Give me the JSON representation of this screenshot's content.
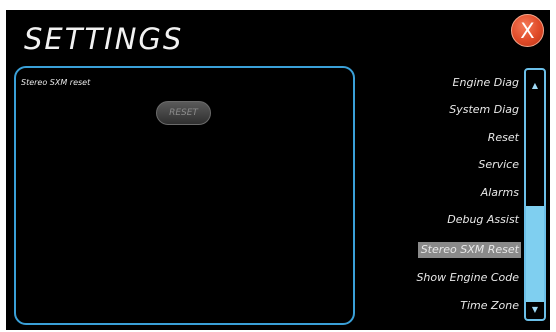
{
  "header": {
    "title": "SETTINGS",
    "close_label": "X"
  },
  "panel": {
    "title": "Stereo SXM reset",
    "reset_label": "RESET"
  },
  "menu": {
    "items": [
      {
        "label": "Engine Diag",
        "selected": false
      },
      {
        "label": "System Diag",
        "selected": false
      },
      {
        "label": "Reset",
        "selected": false
      },
      {
        "label": "Service",
        "selected": false
      },
      {
        "label": "Alarms",
        "selected": false
      },
      {
        "label": "Debug Assist",
        "selected": false
      },
      {
        "label": "Stereo SXM Reset",
        "selected": true
      },
      {
        "label": "Show Engine Code",
        "selected": false
      },
      {
        "label": "Time Zone",
        "selected": false
      }
    ]
  },
  "scrollbar": {
    "up_icon": "chevron-up-icon",
    "down_icon": "chevron-down-icon",
    "position_fraction": 0.55
  },
  "colors": {
    "background": "#000000",
    "accent_blue": "#3aa0d8",
    "scrollbar_fill": "#7fcff0",
    "close_red": "#e04a28",
    "selected_bg": "#8a8a8a"
  }
}
